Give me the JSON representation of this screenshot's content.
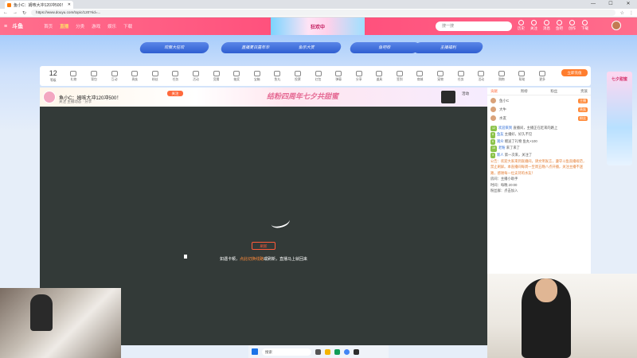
{
  "browser": {
    "tab_title": "鱼小C：姆咳大冲120冲500！",
    "url": "https://www.douyu.com/topic/120?rid=...",
    "window_controls": [
      "—",
      "☐",
      "✕"
    ]
  },
  "site": {
    "logo": "斗鱼",
    "nav": [
      "首页",
      "直播",
      "分类",
      "游戏",
      "娱乐",
      "下载"
    ],
    "active_nav": "直播",
    "banner": "狂欢中",
    "search_placeholder": "搜一搜",
    "header_icons": [
      "历史",
      "关注",
      "消息",
      "鱼吧",
      "创作",
      "下载"
    ],
    "accent": "#ff4c7a"
  },
  "events": [
    "欢聚大狂欢",
    "直播夏日嘉年华",
    "鱼乐大赏",
    "鱼吧荐",
    "主播福利"
  ],
  "toolbar": {
    "level": "12",
    "items": [
      "等级",
      "礼物",
      "背包",
      "互动",
      "贵族",
      "粉丝",
      "任务",
      "活动",
      "竞猜",
      "抽奖",
      "宝箱",
      "鱼丸",
      "投票",
      "红包",
      "弹幕",
      "分享",
      "道具",
      "签到",
      "商城",
      "宠物",
      "任务",
      "活动",
      "购物",
      "帮助",
      "更多"
    ],
    "charge_label": "立即充值"
  },
  "room": {
    "title": "鱼小C：姆咳大冲120冲500！",
    "subtitle": "关注 主播动态 · 分享",
    "follow": "关注",
    "slogan": "结粉四周年七夕共甜蜜",
    "extra": "活动"
  },
  "video": {
    "button": "刷新",
    "tip_prefix": "如遇卡顿，",
    "tip_highlight": "点此切换线路",
    "tip_suffix": "或刷新，直播马上就回来"
  },
  "right_panel": {
    "tabs": [
      "贡献",
      "周榜",
      "粉丝",
      "贵族"
    ],
    "rank": [
      {
        "name": "鱼小C",
        "tag": "主播"
      },
      {
        "name": "大牛",
        "tag": "贵族"
      },
      {
        "name": "水友",
        "tag": "粉丝"
      }
    ],
    "chat": [
      {
        "badge": "12",
        "user": "欢迎来到",
        "text": "直播间，主播正在赶来的路上"
      },
      {
        "badge": "8",
        "user": "鱼友",
        "text": "主播好，好久不见"
      },
      {
        "badge": "6",
        "user": "观众",
        "text": "赠送了礼物 鱼丸×100"
      },
      {
        "badge": "15",
        "user": "老粉",
        "text": "来了来了"
      },
      {
        "badge": "3",
        "user": "新人",
        "text": "第一次来，关注了"
      }
    ],
    "notice": "公告：欢迎大家来到直播间，请文明发言，遵守斗鱼直播规范，禁止刷屏。本直播间每周一至周五晚八点开播，关注主播不迷路，感谢每一位支持的水友！",
    "footer": [
      "房间：主播小助手",
      "时间：每晚 20:00",
      "粉丝群：点击加入"
    ]
  },
  "side_ad": "七夕甜蜜",
  "taskbar": {
    "search": "搜索"
  }
}
